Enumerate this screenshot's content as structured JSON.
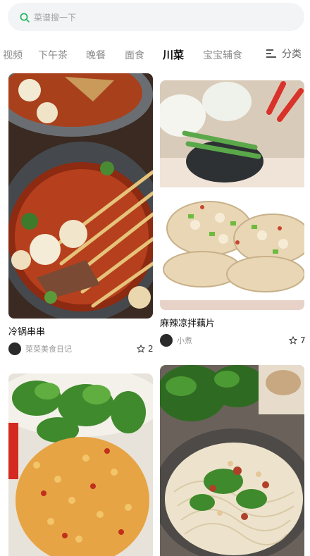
{
  "search": {
    "placeholder": "菜谱搜一下",
    "icon": "search-icon"
  },
  "tabs": [
    {
      "label": "视频"
    },
    {
      "label": "下午茶"
    },
    {
      "label": "晚餐"
    },
    {
      "label": "面食"
    },
    {
      "label": "川菜",
      "active": true
    },
    {
      "label": "宝宝辅食"
    }
  ],
  "categories": {
    "label": "分类",
    "icon": "menu-icon"
  },
  "cards": [
    {
      "title": "冷锅串串",
      "author": "菜菜美食日记",
      "likes": "2"
    },
    {
      "title": "麻辣凉拌藕片",
      "author": "小煮",
      "likes": "7"
    },
    {
      "title": "",
      "author": "",
      "likes": ""
    },
    {
      "title": "",
      "author": "",
      "likes": ""
    }
  ],
  "colors": {
    "accent": "#27b765",
    "active_tab": "#111111",
    "inactive_tab": "#8a8a8a"
  }
}
